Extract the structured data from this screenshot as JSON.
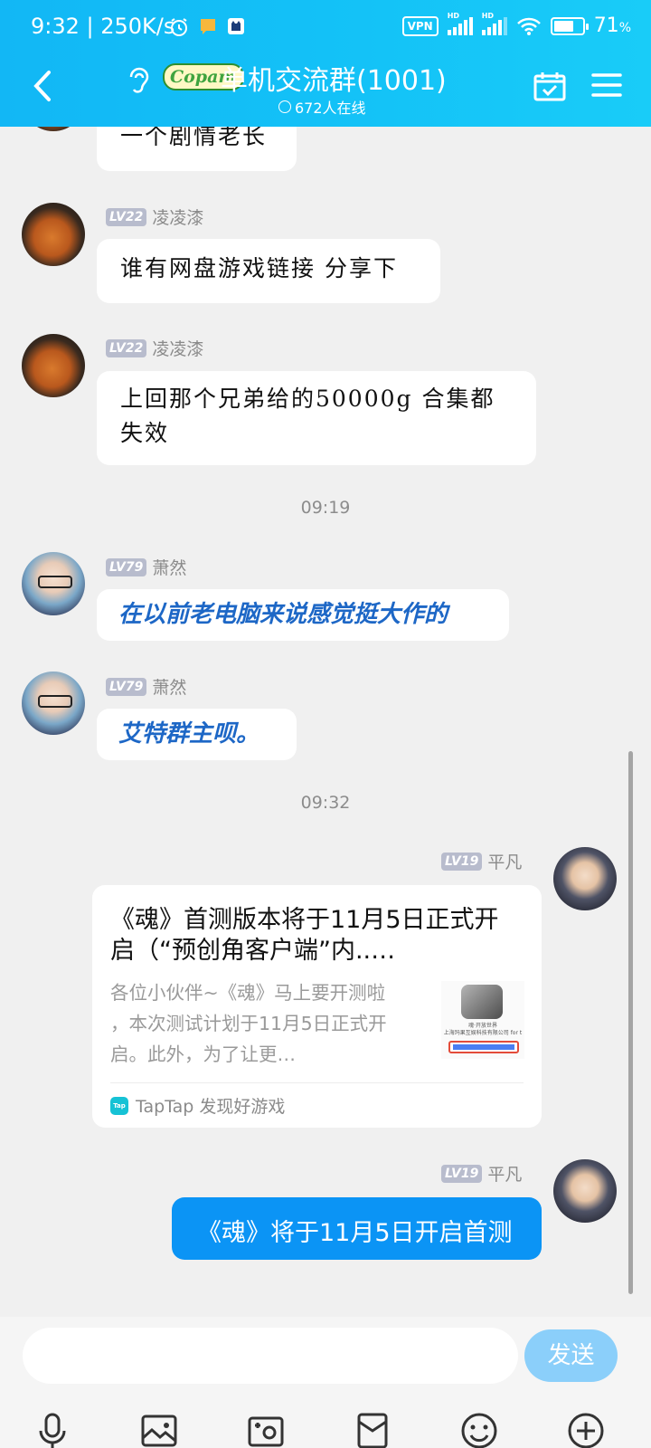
{
  "status": {
    "time": "9:32 | 250K/s",
    "vpn": "VPN",
    "hd": "HD",
    "battery": "71",
    "battery_unit": "%",
    "battery_level": 0.71
  },
  "header": {
    "title": "单机交流群(1001)",
    "brand": "Copam",
    "online": "672人在线"
  },
  "messages": [
    {
      "text": "一个剧情老长"
    },
    {
      "level": "LV22",
      "nick": "凌凌漆",
      "text": "谁有网盘游戏链接 分享下"
    },
    {
      "level": "LV22",
      "nick": "凌凌漆",
      "text_line1": "上回那个兄弟给的50000g  合集都",
      "text_line2": "失效"
    },
    {
      "time": "09:19"
    },
    {
      "level": "LV79",
      "nick": "萧然",
      "text": "在以前老电脑来说感觉挺大作的"
    },
    {
      "level": "LV79",
      "nick": "萧然",
      "text": "艾特群主呗。"
    },
    {
      "time": "09:32"
    },
    {
      "level": "LV19",
      "nick": "平凡"
    },
    {
      "level": "LV19",
      "nick": "平凡",
      "text": "《魂》将于11月5日开启首测"
    }
  ],
  "card": {
    "title_line1": "《魂》首测版本将于11月5日正式开",
    "title_line2": "启（“预创角客户端”内..…",
    "desc_line1": "各位小伙伴~《魂》马上要开测啦",
    "desc_line2": "，本次测试计划于11月5日正式开",
    "desc_line3": "启。此外，为了让更…",
    "thumb_text1": "魂·开放世界",
    "thumb_text2": "上海玛果互娱科技有限公司 for t",
    "source_icon": "Tap",
    "source": "TapTap 发现好游戏"
  },
  "input": {
    "placeholder": "",
    "send": "发送"
  },
  "toolbar": [
    "mic-icon",
    "image-icon",
    "camera-icon",
    "red-packet-icon",
    "emoji-icon",
    "plus-icon"
  ],
  "colors": {
    "header": "#12b7f5",
    "self_bubble": "#0b94f5",
    "send_button": "#8bcffa",
    "bot_text": "#1d67c6"
  }
}
